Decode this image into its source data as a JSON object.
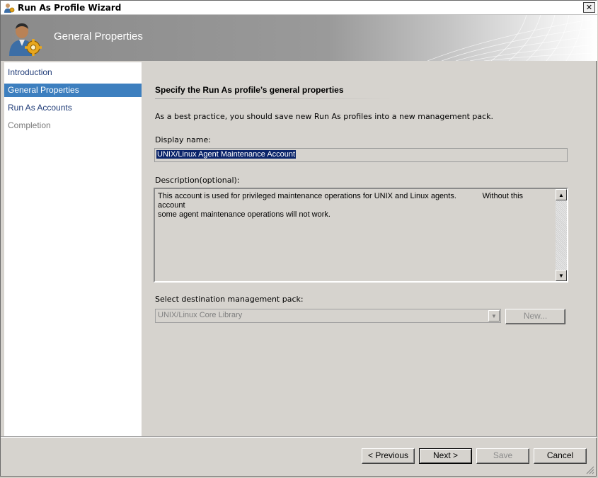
{
  "window": {
    "title": "Run As Profile Wizard",
    "close_glyph": "✕"
  },
  "banner": {
    "title": "General Properties",
    "icon": "user-gear-icon"
  },
  "nav": {
    "items": [
      {
        "label": "Introduction",
        "state": "normal"
      },
      {
        "label": "General Properties",
        "state": "active"
      },
      {
        "label": "Run As Accounts",
        "state": "normal"
      },
      {
        "label": "Completion",
        "state": "disabled"
      }
    ]
  },
  "main": {
    "heading": "Specify the Run As profile’s general properties",
    "instruction": "As a best practice, you should save new Run As profiles into a new management pack.",
    "display_name_label": "Display name:",
    "display_name_value": "UNIX/Linux Agent Maintenance Account",
    "description_label": "Description(optional):",
    "description_value": "This account is used for privileged maintenance operations for UNIX and Linux agents.            Without this account\nsome agent maintenance operations will not work.",
    "mp_label": "Select destination management pack:",
    "mp_value": "UNIX/Linux Core Library",
    "new_button": "New..."
  },
  "footer": {
    "previous": "< Previous",
    "next": "Next >",
    "save": "Save",
    "cancel": "Cancel"
  },
  "colors": {
    "accent": "#3d7fbf",
    "selection": "#0a246a",
    "nav_text": "#1f3b77"
  }
}
